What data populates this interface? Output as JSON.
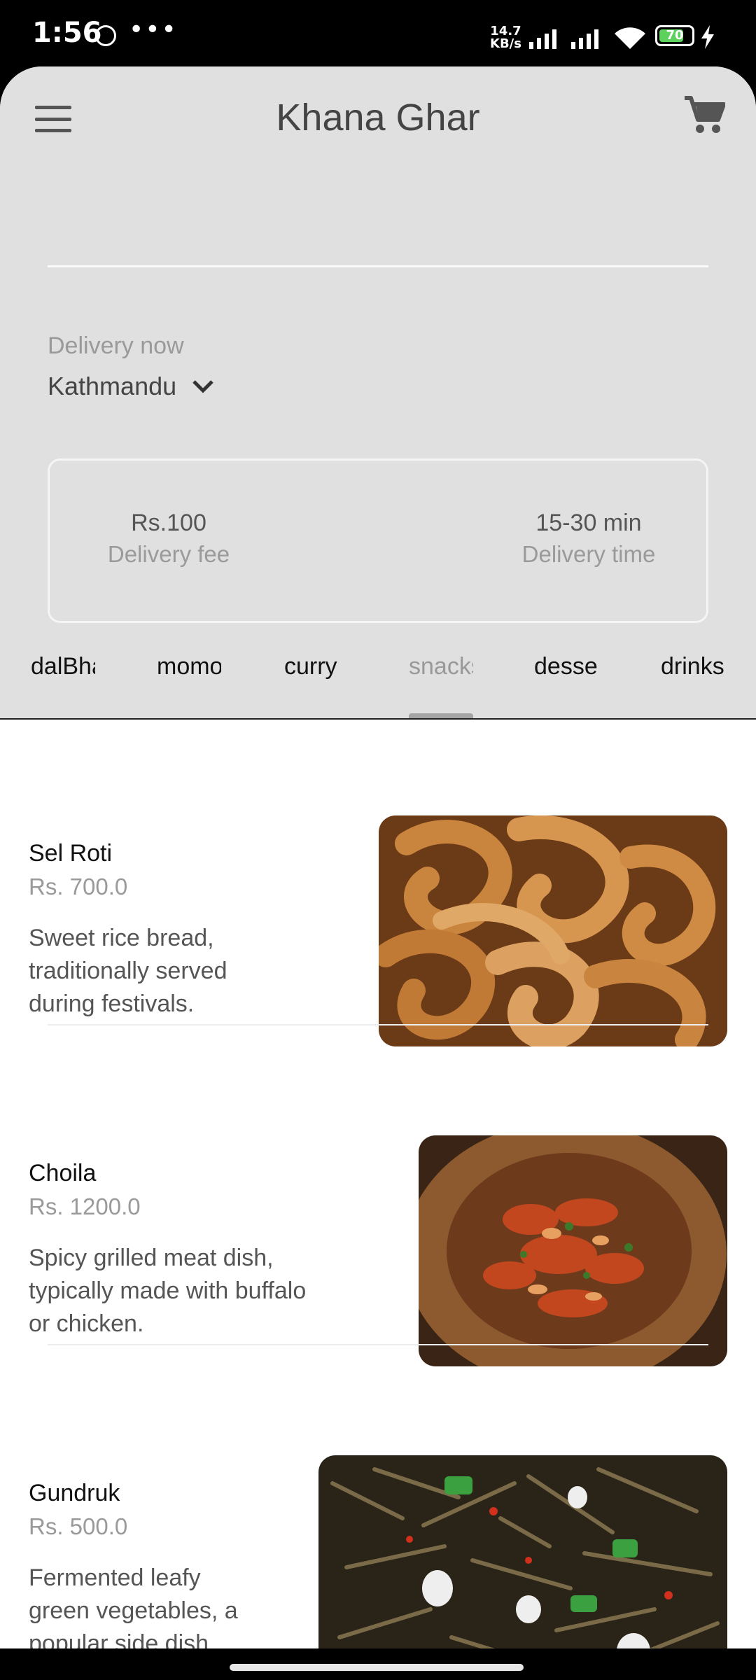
{
  "status_bar": {
    "time": "1:56",
    "dots": "•••",
    "speed_value": "14.7",
    "speed_unit": "KB/s",
    "battery": "70"
  },
  "header": {
    "title": "Khana Ghar",
    "menu_icon": "hamburger-menu-icon",
    "cart_icon": "shopping-cart-icon"
  },
  "delivery": {
    "label": "Delivery now",
    "location": "Kathmandu"
  },
  "info": {
    "fee_value": "Rs.100",
    "fee_label": "Delivery fee",
    "time_value": "15-30 min",
    "time_label": "Delivery time"
  },
  "tabs": [
    {
      "label": "dalBhat"
    },
    {
      "label": "momo"
    },
    {
      "label": "curry"
    },
    {
      "label": "snacks"
    },
    {
      "label": "desserts"
    },
    {
      "label": "drinks"
    }
  ],
  "items": [
    {
      "name": "Sel Roti",
      "price": "Rs. 700.0",
      "desc": [
        "Sweet rice bread,",
        "traditionally served",
        "during festivals."
      ]
    },
    {
      "name": "Choila",
      "price": "Rs. 1200.0",
      "desc": [
        "Spicy grilled meat dish,",
        "typically made with buffalo",
        "or chicken."
      ]
    },
    {
      "name": "Gundruk",
      "price": "Rs. 500.0",
      "desc": [
        "Fermented leafy",
        "green vegetables, a",
        "popular side dish."
      ]
    }
  ],
  "colors": {
    "header_bg": "#e0e0e0",
    "title": "#444444",
    "muted": "#9a9a9a",
    "battery": "#5ed05e"
  }
}
